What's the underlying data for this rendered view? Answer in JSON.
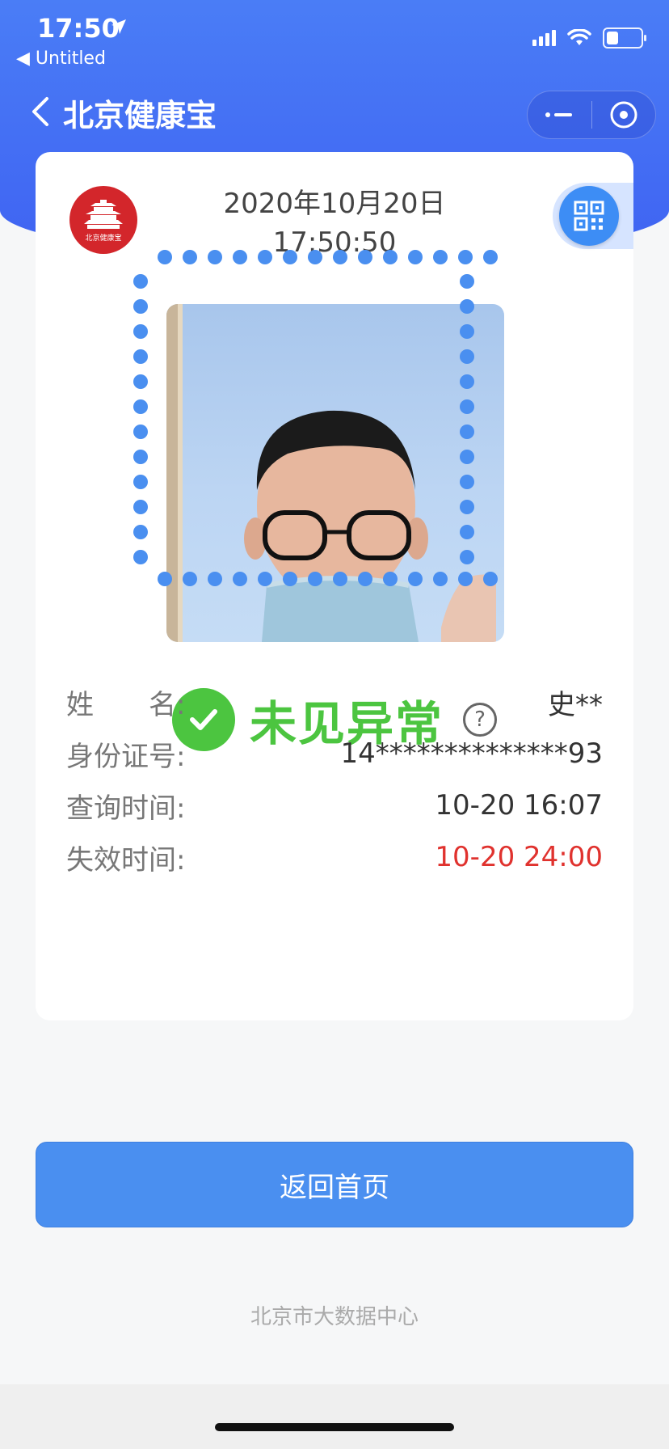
{
  "status_bar": {
    "time": "17:50",
    "back_app": "◀ Untitled"
  },
  "nav": {
    "title": "北京健康宝"
  },
  "card": {
    "logo_text": "北京健康宝",
    "date": "2020年10月20日",
    "time": "17:50:50",
    "status": "未见异常",
    "rows": [
      {
        "label": "姓　　名:",
        "value": "史**"
      },
      {
        "label": "身份证号:",
        "value": "14**************93"
      },
      {
        "label": "查询时间:",
        "value": "10-20 16:07"
      },
      {
        "label": "失效时间:",
        "value": "10-20 24:00"
      }
    ]
  },
  "home_button": "返回首页",
  "footer": "北京市大数据中心",
  "colors": {
    "header_blue": "#4a7df6",
    "status_green": "#4cc540",
    "button_blue": "#4a8ff0",
    "expiry_red": "#e0322e",
    "dot_blue": "#4a8ff0"
  }
}
